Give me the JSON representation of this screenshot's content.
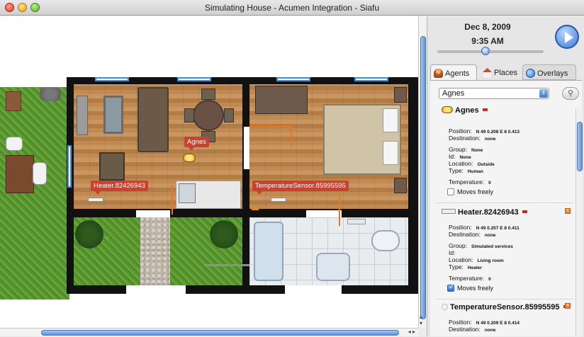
{
  "window": {
    "title": "Simulating House - Acumen Integration - Siafu"
  },
  "map": {
    "labels": {
      "agnes": "Agnes",
      "heater": "Heater.82426943",
      "sensor": "TemperatureSensor.85995595"
    }
  },
  "clock": {
    "date": "Dec 8, 2009",
    "time": "9:35 AM",
    "progress": 0.45
  },
  "tabs": {
    "agents": "Agents",
    "places": "Places",
    "overlays": "Overlays"
  },
  "agent_select": {
    "selected": "Agnes"
  },
  "cards": [
    {
      "name": "Agnes",
      "position_label": "Position:",
      "position": "N 49 0.208 E 8 0.413",
      "destination_label": "Destination:",
      "destination": "none",
      "group_label": "Group:",
      "group": "None",
      "id_label": "Id:",
      "id": "None",
      "location_label": "Location:",
      "location": "Outside",
      "type_label": "Type:",
      "type": "Human",
      "temperature_label": "Temperature:",
      "temperature": "0",
      "moves_label": "Moves freely",
      "moves_checked": false
    },
    {
      "name": "Heater.82426943",
      "position_label": "Position:",
      "position": "N 49 0.207 E 8 0.411",
      "destination_label": "Destination:",
      "destination": "none",
      "group_label": "Group:",
      "group": "Simulated services",
      "id_label": "Id:",
      "id": "",
      "location_label": "Location:",
      "location": "Living room",
      "type_label": "Type:",
      "type": "Heater",
      "temperature_label": "Temperature:",
      "temperature": "0",
      "moves_label": "Moves freely",
      "moves_checked": true
    },
    {
      "name": "TemperatureSensor.85995595",
      "position_label": "Position:",
      "position": "N 49 0.209 E 8 0.414",
      "destination_label": "Destination:",
      "destination": "none"
    }
  ],
  "colors": {
    "accent": "#3d7ad8",
    "label_red": "#c9412f",
    "wall": "#111111",
    "sensor_line": "#e87722"
  }
}
